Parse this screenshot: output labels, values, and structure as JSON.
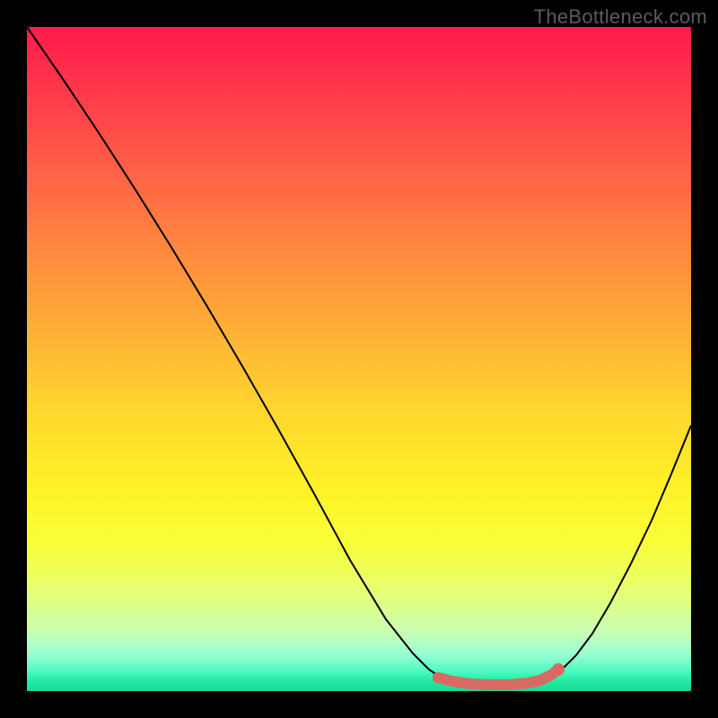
{
  "watermark": "TheBottleneck.com",
  "chart_data": {
    "type": "line",
    "title": "",
    "xlabel": "",
    "ylabel": "",
    "xlim": [
      0,
      100
    ],
    "ylim": [
      0,
      100
    ],
    "series": [
      {
        "name": "curve",
        "x": [
          0,
          5,
          11,
          16,
          22,
          27,
          32,
          38,
          43,
          49,
          54,
          58,
          61,
          62,
          64,
          66,
          69,
          72,
          74,
          77,
          79,
          81,
          83,
          85,
          88,
          91,
          94,
          97,
          100
        ],
        "y": [
          100,
          92,
          84,
          76,
          67,
          58,
          49,
          39,
          30,
          20,
          11,
          6,
          3,
          2,
          1.5,
          1,
          1,
          1,
          1.2,
          1.5,
          2,
          3,
          5,
          9,
          13,
          19,
          26,
          33,
          40
        ]
      }
    ],
    "highlight_range_x": [
      62,
      80
    ],
    "background": "vertical-gradient red→yellow→green"
  }
}
